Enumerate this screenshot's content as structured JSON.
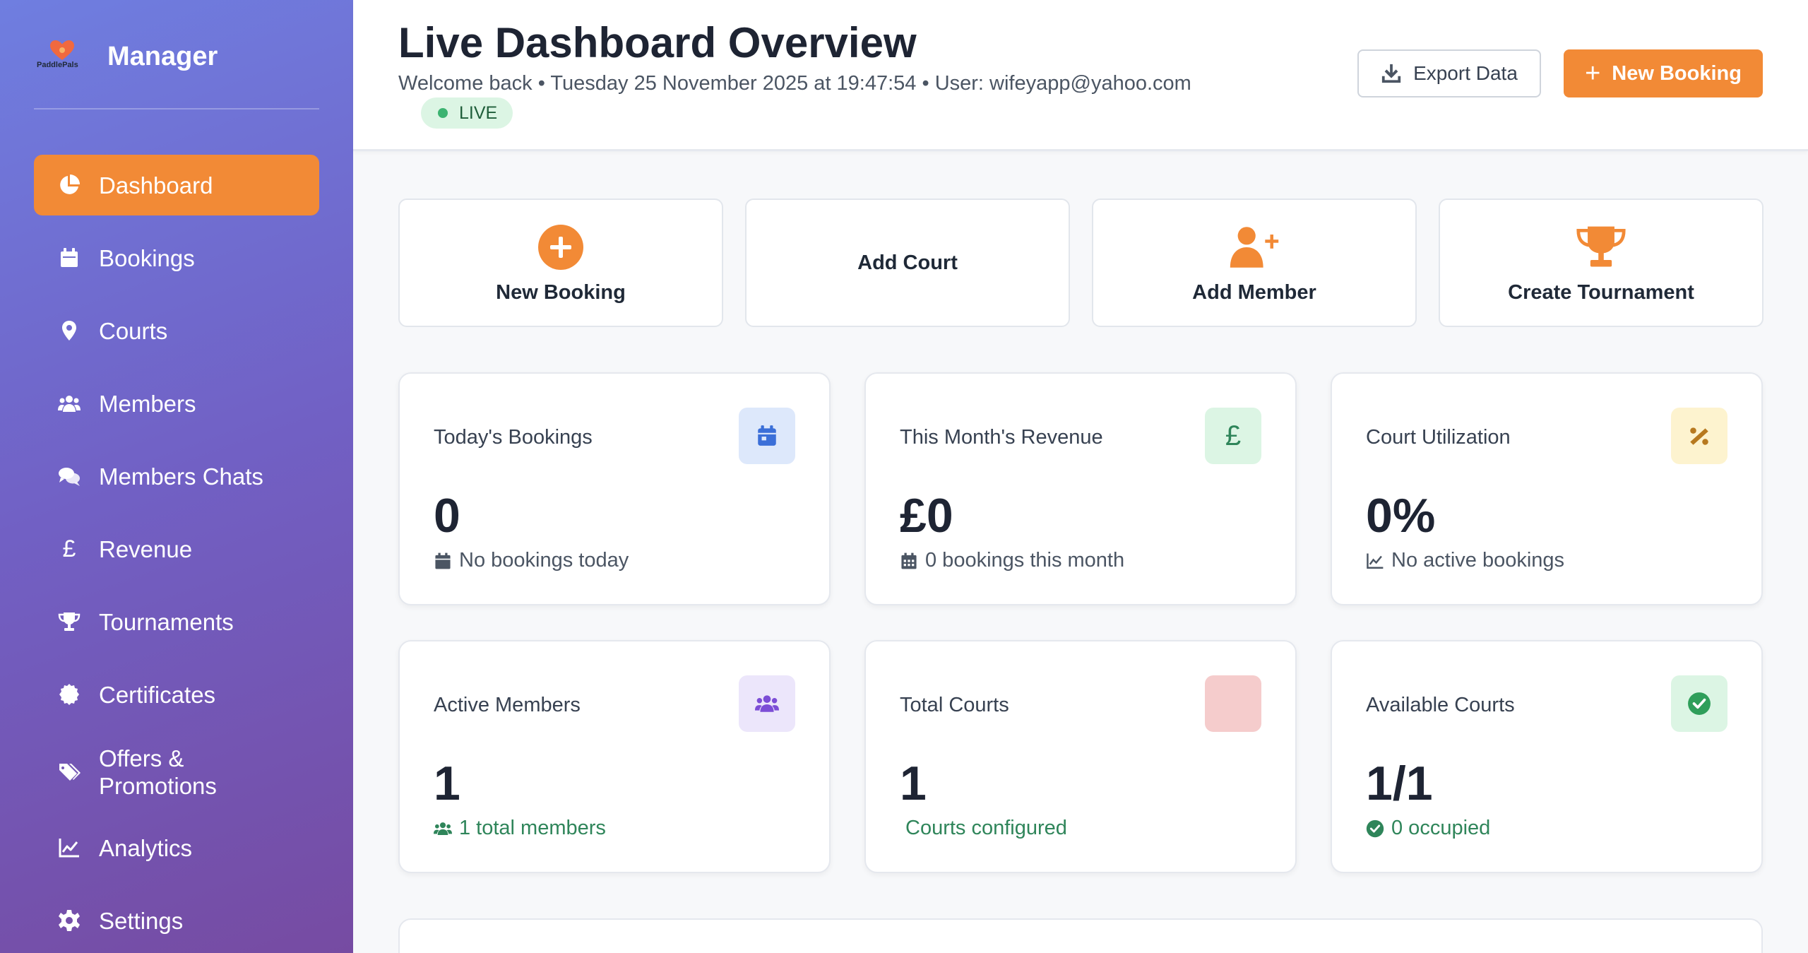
{
  "sidebar": {
    "brand_logo_text": "PaddlePals",
    "brand_title": "Manager",
    "items": [
      {
        "label": "Dashboard",
        "icon": "pie-chart-icon",
        "active": true
      },
      {
        "label": "Bookings",
        "icon": "calendar-icon"
      },
      {
        "label": "Courts",
        "icon": "map-pin-icon"
      },
      {
        "label": "Members",
        "icon": "users-icon"
      },
      {
        "label": "Members Chats",
        "icon": "chat-icon"
      },
      {
        "label": "Revenue",
        "icon": "pound-icon",
        "glyph": "£"
      },
      {
        "label": "Tournaments",
        "icon": "trophy-icon"
      },
      {
        "label": "Certificates",
        "icon": "certificate-icon"
      },
      {
        "label": "Offers & Promotions",
        "icon": "tags-icon"
      },
      {
        "label": "Analytics",
        "icon": "line-chart-icon"
      },
      {
        "label": "Settings",
        "icon": "gear-icon"
      }
    ]
  },
  "header": {
    "title": "Live Dashboard Overview",
    "subtitle": "Welcome back • Tuesday 25 November 2025 at 19:47:54 • User: wifeyapp@yahoo.com",
    "live_label": "LIVE",
    "export_label": "Export Data",
    "new_booking_label": "New Booking"
  },
  "quick_actions": [
    {
      "label": "New Booking",
      "icon": "plus-circle-icon"
    },
    {
      "label": "Add Court",
      "icon": ""
    },
    {
      "label": "Add Member",
      "icon": "user-plus-icon"
    },
    {
      "label": "Create Tournament",
      "icon": "trophy-icon"
    }
  ],
  "stats": [
    {
      "title": "Today's Bookings",
      "value": "0",
      "sub": "No bookings today",
      "icon": "calendar-icon",
      "icon_bg": "#dde8fb",
      "icon_color": "#3b6fd8",
      "sub_icon": "calendar-icon"
    },
    {
      "title": "This Month's Revenue",
      "value": "£0",
      "sub": "0 bookings this month",
      "icon": "pound-icon",
      "icon_glyph": "£",
      "icon_bg": "#dcf5e4",
      "icon_color": "#2f855a",
      "sub_icon": "calendar-grid-icon"
    },
    {
      "title": "Court Utilization",
      "value": "0%",
      "sub": "No active bookings",
      "icon": "percent-icon",
      "icon_bg": "#fdf3cf",
      "icon_color": "#b7791f",
      "sub_icon": "line-chart-icon"
    },
    {
      "title": "Active Members",
      "value": "1",
      "sub": "1 total members",
      "icon": "users-icon",
      "icon_bg": "#ece6fb",
      "icon_color": "#7c4dd6",
      "sub_icon": "users-icon",
      "sub_green": true
    },
    {
      "title": "Total Courts",
      "value": "1",
      "sub": "Courts configured",
      "icon": "",
      "icon_bg": "#f5cccc",
      "icon_color": "#e05a5a",
      "sub_icon": "",
      "sub_green": true
    },
    {
      "title": "Available Courts",
      "value": "1/1",
      "sub": "0 occupied",
      "icon": "check-circle-icon",
      "icon_bg": "#dcf5e4",
      "icon_color": "#2f9e5a",
      "sub_icon": "check-circle-icon",
      "sub_green": true
    }
  ],
  "colors": {
    "accent": "#f28a36",
    "sidebar_start": "#6f7ee0",
    "sidebar_end": "#764ba2"
  }
}
